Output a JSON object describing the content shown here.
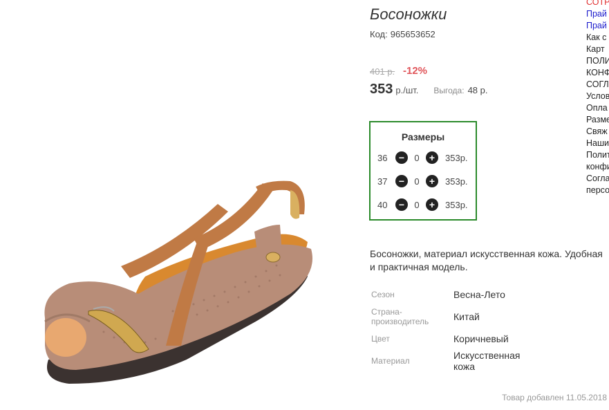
{
  "product": {
    "title": "Босоножки",
    "code_label": "Код:",
    "code": "965653652",
    "old_price": "401 р.",
    "discount": "-12%",
    "price": "353",
    "price_unit": "р./шт.",
    "benefit_label": "Выгода:",
    "benefit_value": "48 р.",
    "image_icon": "sandal-photo"
  },
  "sizes": {
    "title": "Размеры",
    "rows": [
      {
        "size": "36",
        "qty": "0",
        "price": "353р."
      },
      {
        "size": "37",
        "qty": "0",
        "price": "353р."
      },
      {
        "size": "40",
        "qty": "0",
        "price": "353р."
      }
    ],
    "minus_symbol": "−",
    "plus_symbol": "+"
  },
  "description": "Босоножки, материал искусственная кожа. Удобная и практичная модель.",
  "attributes": [
    {
      "label": "Сезон",
      "value": "Весна-Лето"
    },
    {
      "label": "Страна-производитель",
      "value": "Китай"
    },
    {
      "label": "Цвет",
      "value": "Коричневый"
    },
    {
      "label": "Материал",
      "value": "Искусственная кожа"
    }
  ],
  "added_date": "Товар добавлен 11.05.2018",
  "side_links": [
    "СОТР",
    "Прай",
    "Прай",
    "Как с",
    "Карт",
    "ПОЛИ",
    "КОНФ",
    "СОГЛ",
    "Услов",
    "Опла",
    "Разме",
    "Свяж",
    "Наши",
    "Полит",
    "конфи",
    "Согла",
    "персо"
  ],
  "colors": {
    "accent_green": "#2a8a2a",
    "discount_red": "#e0555a",
    "link_blue": "#1a1acc",
    "link_red": "#e03030"
  }
}
